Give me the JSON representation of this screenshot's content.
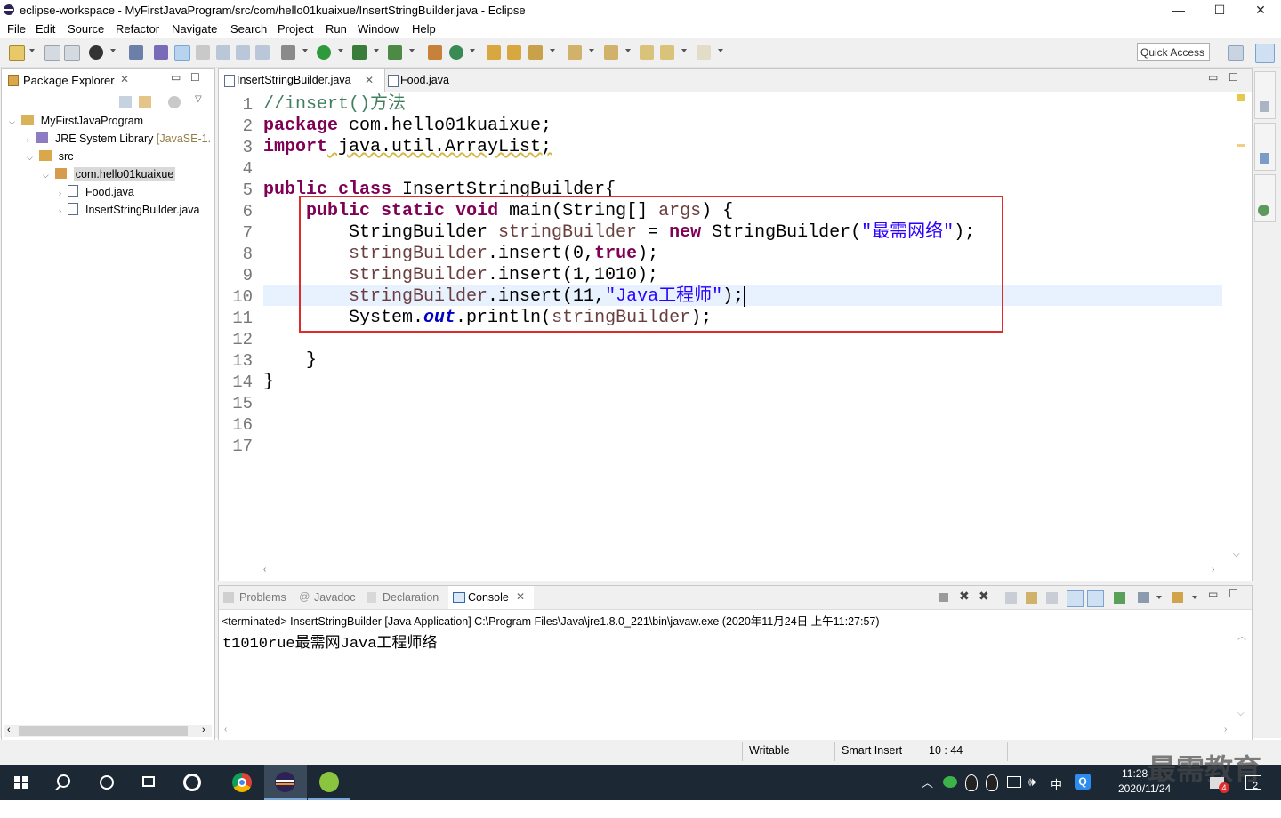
{
  "window": {
    "title": "eclipse-workspace - MyFirstJavaProgram/src/com/hello01kuaixue/InsertStringBuilder.java - Eclipse",
    "minimize": "—",
    "maximize": "☐",
    "close": "✕"
  },
  "menu": [
    "File",
    "Edit",
    "Source",
    "Refactor",
    "Navigate",
    "Search",
    "Project",
    "Run",
    "Window",
    "Help"
  ],
  "toolbar": {
    "quick_access": "Quick Access"
  },
  "package_explorer": {
    "title": "Package Explorer",
    "tree": [
      {
        "label": "MyFirstJavaProgram",
        "suffix": ""
      },
      {
        "label": "JRE System Library",
        "suffix": "[JavaSE-1."
      },
      {
        "label": "src",
        "suffix": ""
      },
      {
        "label": "com.hello01kuaixue",
        "suffix": ""
      },
      {
        "label": "Food.java",
        "suffix": ""
      },
      {
        "label": "InsertStringBuilder.java",
        "suffix": ""
      }
    ]
  },
  "editor": {
    "tabs": [
      "InsertStringBuilder.java",
      "Food.java"
    ],
    "line_numbers": [
      "1",
      "2",
      "3",
      "4",
      "5",
      "6",
      "7",
      "8",
      "9",
      "10",
      "11",
      "12",
      "13",
      "14",
      "15",
      "16",
      "17"
    ],
    "code": {
      "l1_comment": "//insert()方法",
      "l2_kw": "package",
      "l2_rest": " com.hello01kuaixue;",
      "l3_kw": "import",
      "l3_rest": " java.util.ArrayList;",
      "l5_kw1": "public",
      "l5_kw2": "class",
      "l5_rest": " InsertStringBuilder{",
      "l6_kw1": "public",
      "l6_kw2": "static",
      "l6_kw3": "void",
      "l6_rest": " main(String[] ",
      "l6_var": "args",
      "l6_end": ") {",
      "l7_a": "StringBuilder ",
      "l7_var": "stringBuilder",
      "l7_b": " = ",
      "l7_kw": "new",
      "l7_c": " StringBuilder(",
      "l7_str": "\"最需网络\"",
      "l7_d": ");",
      "l8_var": "stringBuilder",
      "l8_a": ".insert(0,",
      "l8_kw": "true",
      "l8_b": ");",
      "l9_var": "stringBuilder",
      "l9_a": ".insert(1,1010);",
      "l10_var": "stringBuilder",
      "l10_a": ".insert(11,",
      "l10_str": "\"Java工程师\"",
      "l10_b": ");",
      "l11_a": "System.",
      "l11_fld": "out",
      "l11_b": ".println(",
      "l11_var": "stringBuilder",
      "l11_c": ");",
      "l13": "}",
      "l14": "}"
    }
  },
  "console": {
    "tabs": [
      "Problems",
      "Javadoc",
      "Declaration",
      "Console"
    ],
    "header": "<terminated> InsertStringBuilder [Java Application] C:\\Program Files\\Java\\jre1.8.0_221\\bin\\javaw.exe (2020年11月24日 上午11:27:57)",
    "output": "t1010rue最需网Java工程师络"
  },
  "status": {
    "writable": "Writable",
    "insert_mode": "Smart Insert",
    "position": "10 : 44"
  },
  "taskbar": {
    "time": "11:28",
    "date": "2020/11/24",
    "ime": "中",
    "watermark": "最需教育",
    "notif_count": "2",
    "badge": "4"
  },
  "colors": {
    "keyword": "#7f0055",
    "string": "#2a00ff",
    "comment": "#3f7f5f",
    "highlight_box": "#e02b2b",
    "taskbar": "#1c2833"
  }
}
